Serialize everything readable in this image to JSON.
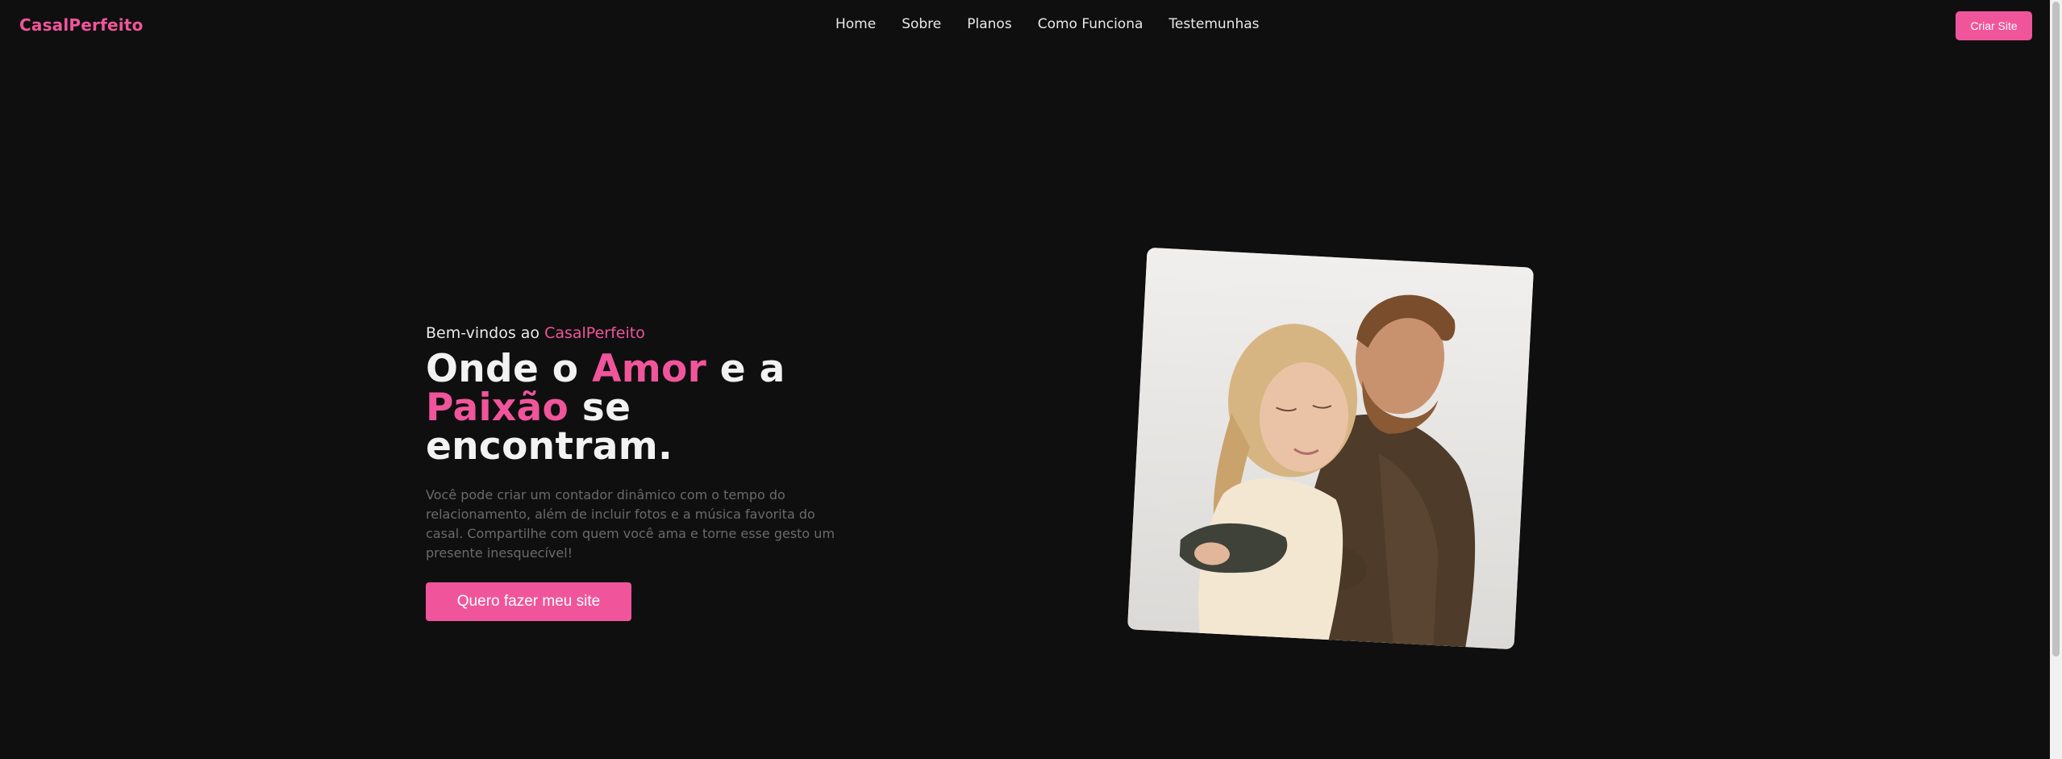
{
  "header": {
    "brand": "CasalPerfeito",
    "nav": [
      "Home",
      "Sobre",
      "Planos",
      "Como Funciona",
      "Testemunhas"
    ],
    "cta_label": "Criar Site"
  },
  "hero": {
    "welcome_prefix": "Bem-vindos ao ",
    "welcome_brand": "CasalPerfeito",
    "headline_part1": "Onde o ",
    "headline_accent1": "Amor",
    "headline_part2": " e a",
    "headline_accent2": "Paixão",
    "headline_part3": " se encontram.",
    "description": "Você pode criar um contador dinâmico com o tempo do relacionamento, além de incluir fotos e a música favorita do casal. Compartilhe com quem você ama e torne esse gesto um presente inesquecível!",
    "cta_label": "Quero fazer meu site"
  },
  "colors": {
    "accent": "#f0559b",
    "background": "#0f0f0f",
    "text": "#f2f2f2",
    "muted_text": "#6a6a6a"
  }
}
